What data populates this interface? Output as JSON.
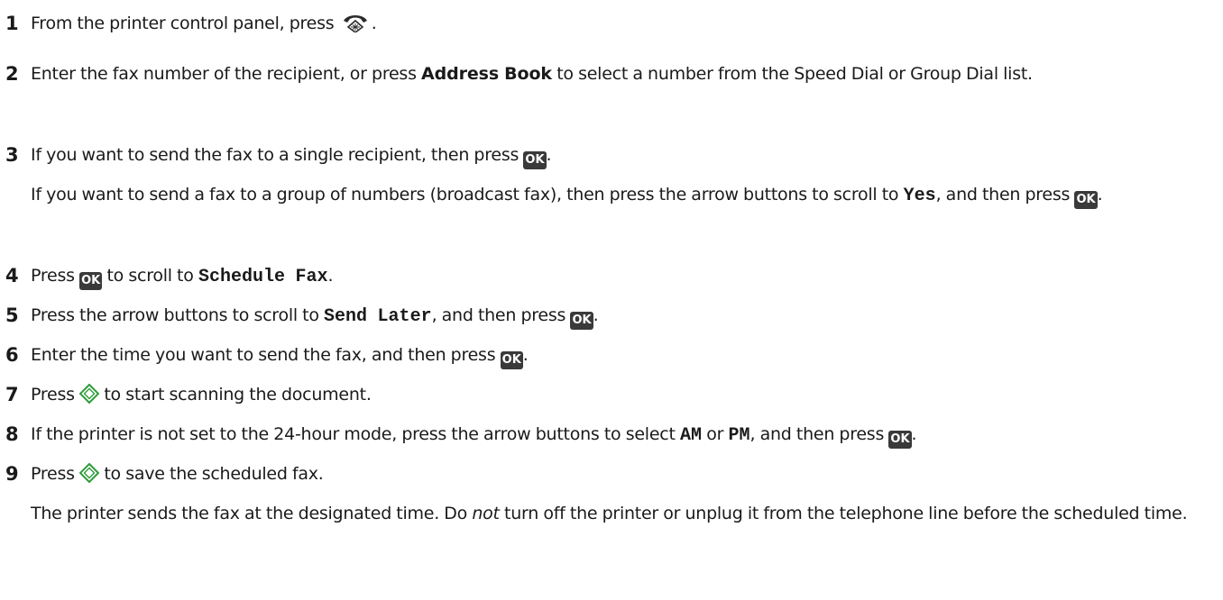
{
  "steps": [
    {
      "number": "1",
      "text_before": "From the printer control panel, press",
      "text_after": "."
    },
    {
      "number": "2",
      "text_before": "Enter the fax number of the recipient, or press",
      "bold": "Address Book",
      "text_after": "to select a number from the Speed Dial or Group Dial list."
    },
    {
      "number": "3",
      "text_before": "If you want to send the fax to a single recipient, then press",
      "text_after": ".",
      "text2_before": "If you want to send a fax to a group of numbers (broadcast fax), then press the arrow buttons to scroll to",
      "mono": "Yes",
      "text2_middle": ", and then press",
      "text2_after": "."
    },
    {
      "number": "4",
      "text_before": "Press",
      "text_middle": "to scroll to",
      "mono": "Schedule Fax",
      "text_after": "."
    },
    {
      "number": "5",
      "text_before": "Press the arrow buttons to scroll to",
      "mono": "Send Later",
      "text_middle": ", and then press",
      "text_after": "."
    },
    {
      "number": "6",
      "text_before": "Enter the time you want to send the fax, and then press",
      "text_after": "."
    },
    {
      "number": "7",
      "text_before": "Press",
      "text_after": "to start scanning the document."
    },
    {
      "number": "8",
      "text_before": "If the printer is not set to the 24-hour mode, press the arrow buttons to select",
      "mono1": "AM",
      "text_or": "or",
      "mono2": "PM",
      "text_middle": ", and then press",
      "text_after": "."
    },
    {
      "number": "9",
      "text_before": "Press",
      "text_after": "to save the scheduled fax.",
      "text2_before": "The printer sends the fax at the designated time. Do",
      "italic": "not",
      "text2_after": "turn off the printer or unplug it from the telephone line before the scheduled time."
    }
  ],
  "ok_label": "OK",
  "icons": {
    "fax": "fax-icon",
    "ok": "ok-button-icon",
    "start": "start-diamond-icon"
  },
  "colors": {
    "text": "#1a1a1a",
    "ok_bg": "#3a3a3a",
    "start_icon": "#2f9c3a"
  }
}
